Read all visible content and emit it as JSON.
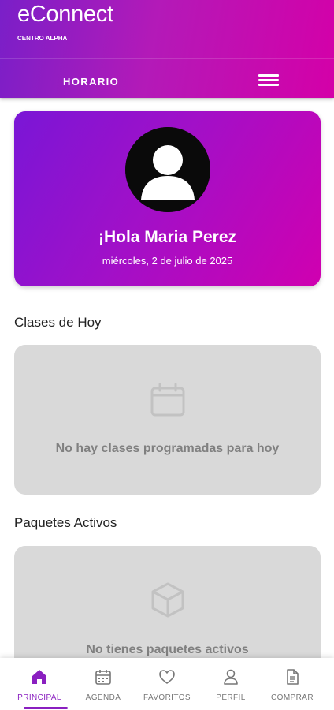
{
  "header": {
    "app_name": "eConnect",
    "center_name": "CENTRO ALPHA",
    "nav_label": "HORARIO",
    "menu_icon": "hamburger-menu-icon"
  },
  "greeting_card": {
    "avatar_icon": "user-avatar-icon",
    "greeting": "¡Hola Maria Perez",
    "date": "miércoles, 2 de julio de 2025"
  },
  "classes_today": {
    "title": "Clases de Hoy",
    "icon": "calendar-icon",
    "empty_message": "No hay clases programadas para hoy"
  },
  "active_packages": {
    "title": "Paquetes Activos",
    "icon": "box-icon",
    "empty_message": "No tienes paquetes activos"
  },
  "bottom_nav": {
    "items": [
      {
        "label": "PRINCIPAL",
        "icon": "home-icon",
        "active": true
      },
      {
        "label": "AGENDA",
        "icon": "calendar-icon",
        "active": false
      },
      {
        "label": "FAVORITOS",
        "icon": "heart-icon",
        "active": false
      },
      {
        "label": "PERFIL",
        "icon": "user-icon",
        "active": false
      },
      {
        "label": "COMPRAR",
        "icon": "document-icon",
        "active": false
      }
    ]
  },
  "colors": {
    "brand_purple": "#8a1fc0",
    "brand_magenta": "#d400a8",
    "empty_card_bg": "#d9d9d9"
  }
}
